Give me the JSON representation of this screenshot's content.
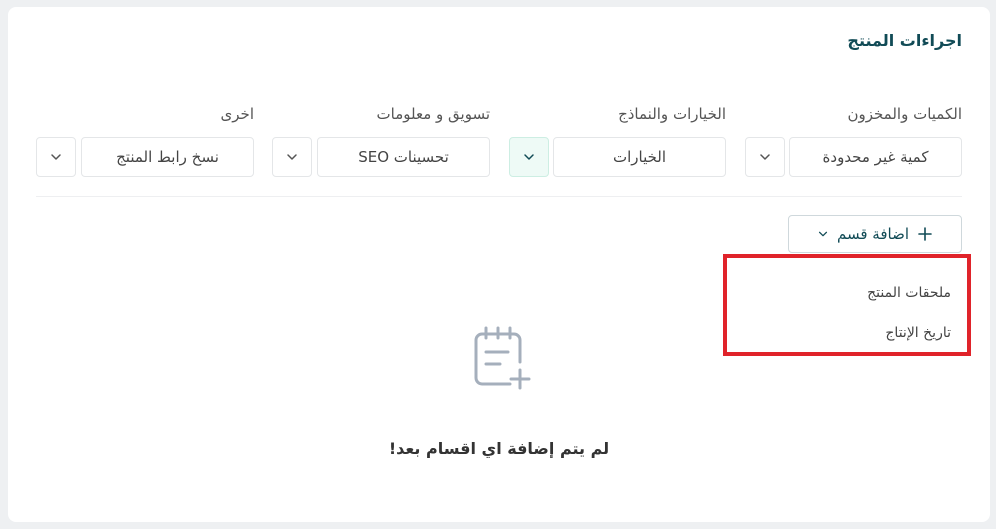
{
  "card": {
    "title": "اجراءات المنتج"
  },
  "groups": [
    {
      "label": "الكميات والمخزون",
      "value": "كمية غير محدودة"
    },
    {
      "label": "الخيارات والنماذج",
      "value": "الخيارات"
    },
    {
      "label": "تسويق و معلومات",
      "value": "تحسينات SEO"
    },
    {
      "label": "اخرى",
      "value": "نسخ رابط المنتج"
    }
  ],
  "add_section": {
    "label": "اضافة قسم"
  },
  "dropdown": {
    "items": [
      "ملحقات المنتج",
      "تاريخ الإنتاج"
    ]
  },
  "empty_state": {
    "text": "لم يتم إضافة اي اقسام بعد!"
  },
  "colors": {
    "accent": "#114b56",
    "highlight": "#e0232a",
    "active_bg": "#eefaf6"
  },
  "icons": {
    "chevron": "chevron-down-icon",
    "plus": "plus-icon",
    "empty": "notepad-plus-icon"
  }
}
